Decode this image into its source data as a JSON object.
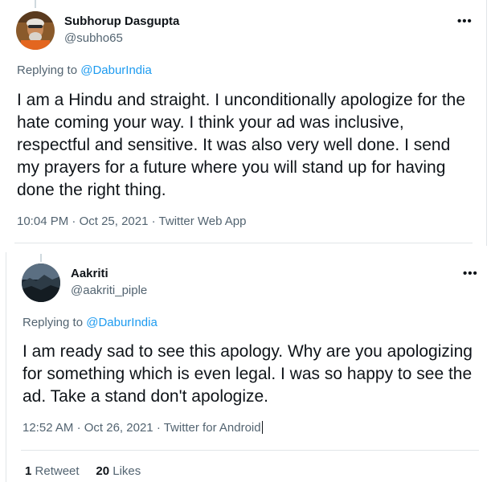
{
  "tweets": [
    {
      "author": {
        "name": "Subhorup Dasgupta",
        "handle": "@subho65"
      },
      "more_label": "•••",
      "replying_to": {
        "prefix": "Replying to",
        "mention": "@DaburIndia"
      },
      "text": "I am a Hindu and straight. I unconditionally apologize for the hate coming your way. I think your ad was inclusive, respectful and sensitive. It was also very well done. I send my prayers for a future where you will stand up for having done the right thing.",
      "time": "10:04 PM",
      "date": "Oct 25, 2021",
      "source": "Twitter Web App",
      "separator": "·"
    },
    {
      "author": {
        "name": "Aakriti",
        "handle": "@aakriti_piple"
      },
      "more_label": "•••",
      "replying_to": {
        "prefix": "Replying to",
        "mention": "@DaburIndia"
      },
      "text": "I am ready sad to see this apology. Why are you apologizing for something which is even legal. I was so happy to see the ad. Take a stand don't apologize.",
      "time": "12:52 AM",
      "date": "Oct 26, 2021",
      "source": "Twitter for Android",
      "separator": "·",
      "stats": {
        "retweets_count": "1",
        "retweets_label": "Retweet",
        "likes_count": "20",
        "likes_label": "Likes"
      }
    }
  ]
}
